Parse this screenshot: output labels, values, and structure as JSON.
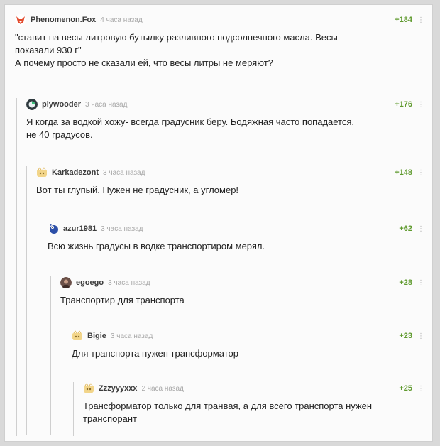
{
  "comments": [
    {
      "username": "Phenomenon.Fox",
      "time": "4 часа назад",
      "rating": "+184",
      "text": "\"ставит на весы литровую бутылку разливного подсолнечного масла. Весы\nпоказали 930 г\"\nА почему просто не сказали ей, что весы литры не меряют?",
      "avatar_icon": "fox-avatar-icon",
      "avatar_color": "#e24a2c"
    },
    {
      "username": "plywooder",
      "time": "3 часа назад",
      "rating": "+176",
      "text": "Я когда за водкой хожу- всегда градусник беру. Бодяжная часто попадается,\nне 40 градусов.",
      "avatar_icon": "plywooder-avatar-icon",
      "avatar_color": "#2f3a3f"
    },
    {
      "username": "Karkadezont",
      "time": "3 часа назад",
      "rating": "+148",
      "text": "Вот ты глупый. Нужен не градусник, а угломер!",
      "avatar_icon": "default-avatar-icon",
      "avatar_color": "#f2d58a"
    },
    {
      "username": "azur1981",
      "time": "3 часа назад",
      "rating": "+62",
      "text": "Всю жизнь градусы в водке транспортиром мерял.",
      "avatar_icon": "azur-avatar-icon",
      "avatar_color": "#2c4fa8"
    },
    {
      "username": "egoego",
      "time": "3 часа назад",
      "rating": "+28",
      "text": "Транспортир для транспорта",
      "avatar_icon": "egoego-avatar-icon",
      "avatar_color": "#6b5048"
    },
    {
      "username": "Bigie",
      "time": "3 часа назад",
      "rating": "+23",
      "text": "Для транспорта нужен трансформатор",
      "avatar_icon": "default-avatar-icon",
      "avatar_color": "#f2d58a"
    },
    {
      "username": "Zzzyyyxxx",
      "time": "2 часа назад",
      "rating": "+25",
      "text": "Трансформатор только для транвая, а для всего транспорта нужен\nтранспорант",
      "avatar_icon": "default-avatar-icon",
      "avatar_color": "#f2d58a"
    }
  ]
}
